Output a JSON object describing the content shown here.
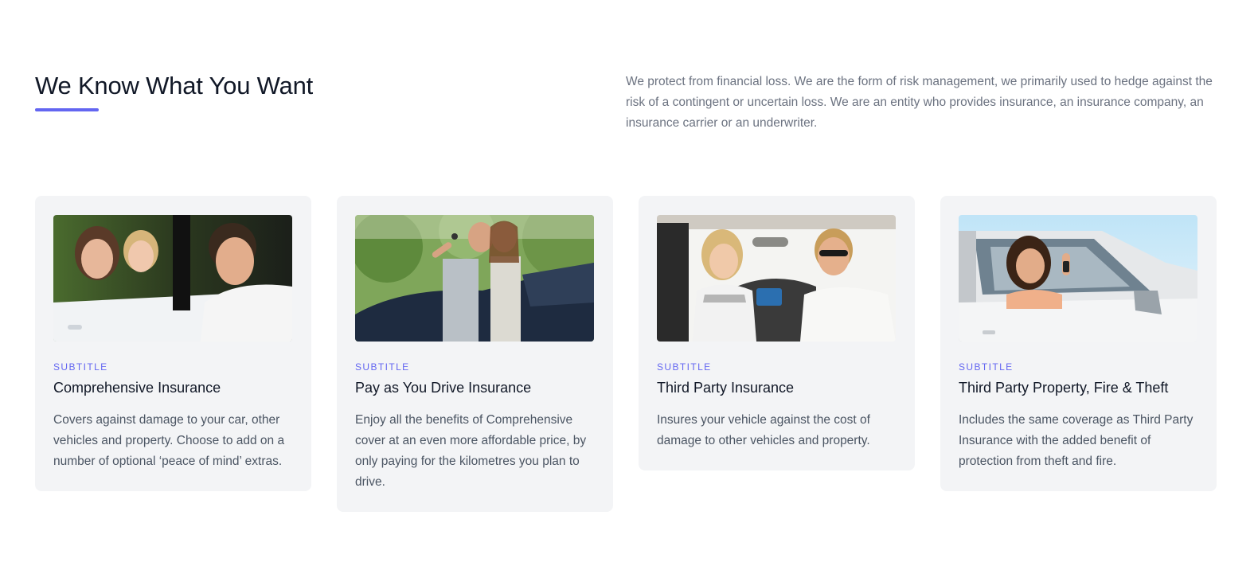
{
  "section": {
    "heading": "We Know What You Want",
    "intro": "We protect from financial loss. We are the form of risk management, we primarily used to hedge against the risk of a contingent or uncertain loss. We are an entity who provides insurance, an insurance company, an insurance carrier or an underwriter.",
    "accent_color": "#6366f1"
  },
  "cards": [
    {
      "image": "family-in-car-photo",
      "subtitle": "SUBTITLE",
      "title": "Comprehensive Insurance",
      "description": "Covers against damage to your car, other vehicles and property. Choose to add on a number of optional ‘peace of mind’ extras."
    },
    {
      "image": "couple-with-car-keys-photo",
      "subtitle": "SUBTITLE",
      "title": "Pay as You Drive Insurance",
      "description": "Enjoy all the benefits of Comprehensive cover at an even more affordable price, by only paying for the kilometres you plan to drive."
    },
    {
      "image": "couple-inside-car-photo",
      "subtitle": "SUBTITLE",
      "title": "Third Party Insurance",
      "description": "Insures your vehicle against the cost of damage to other vehicles and property."
    },
    {
      "image": "woman-with-keys-in-car-photo",
      "subtitle": "SUBTITLE",
      "title": "Third Party Property, Fire & Theft",
      "description": "Includes the same coverage as Third Party Insurance with the added benefit of protection from theft and fire."
    }
  ]
}
